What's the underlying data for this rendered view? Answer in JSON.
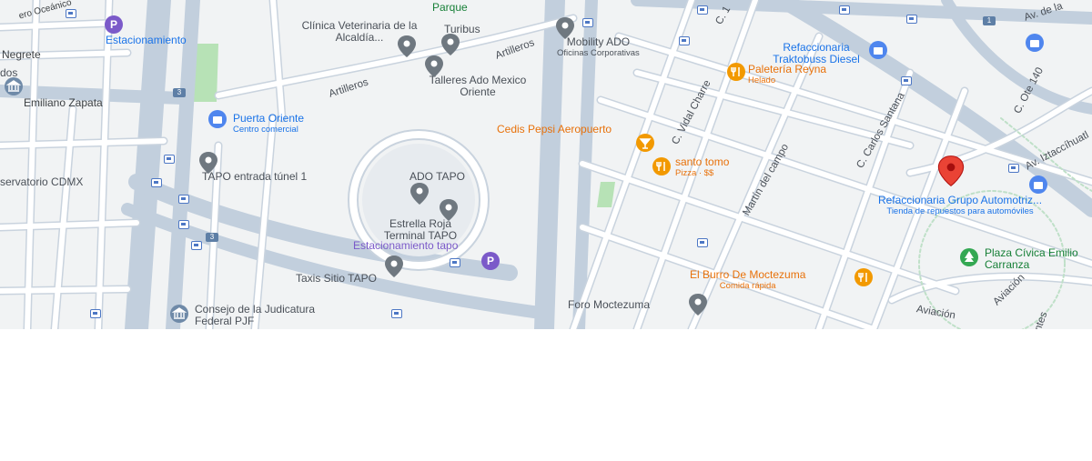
{
  "map": {
    "colors": {
      "background": "#f1f3f4",
      "road": "#ffffff",
      "road_outline": "#c9d3de",
      "highway": "#c2cfdd",
      "park": "#b7e2b6",
      "gray_pin": "#6f7880",
      "blue_pin": "#4f86ee",
      "orange_pin": "#f29900",
      "purple_pin": "#7b5ac9",
      "green_pin": "#34a853",
      "red_marker": "#ea4335"
    },
    "roads": {
      "oceanico": "ero Oceánico",
      "negrete": "Negrete",
      "emiliano_zapata": "Emiliano Zapata",
      "artilleros_1": "Artilleros",
      "artilleros_2": "Artilleros",
      "vidal_charre": "C. Vidal Charre",
      "martin_del_campo": "Martín del campo",
      "carlos_santana": "C. Carlos Santana",
      "ote_140": "C. Ote 140",
      "izazaga": "Av. Iztaccíhuatl",
      "aviacion_1": "Aviación",
      "aviacion_2": "Aviación",
      "av_de_la": "Av. de la",
      "c1": "C. 1",
      "intes": "intes"
    },
    "shields": [
      "3",
      "3",
      "1"
    ],
    "places": {
      "estacionamiento": "Estacionamiento",
      "parque": "Parque",
      "veterinaria": "Clínica Veterinaria de la Alcaldía...",
      "turibus": "Turibus",
      "mobility_ado": "Mobility ADO",
      "mobility_ado_sub": "Oficinas Corporativas",
      "refaccionaria_traktobuss": "Refaccionaria Traktobuss Diesel",
      "paleteria": "Paletería Reyna",
      "paleteria_sub": "Helado",
      "talleres_ado": "Talleres Ado Mexico Oriente",
      "dos": "dos",
      "puerta_oriente": "Puerta Oriente",
      "puerta_oriente_sub": "Centro comercial",
      "cedis_pepsi": "Cedis Pepsi Aeropuerto",
      "santo_tomo": "santo tomo",
      "santo_tomo_sub": "Pizza · $$",
      "tapo_tunel": "TAPO entrada túnel 1",
      "observatorio": "servatorio CDMX",
      "ado_tapo": "ADO TAPO",
      "estrella_roja": "Estrella Roja Terminal TAPO",
      "refaccionaria_grupo": "Refaccionaria Grupo Automotriz...",
      "refaccionaria_grupo_sub": "Tienda de repuestos para automóviles",
      "estacionamiento_tapo": "Estacionamiento tapo",
      "plaza_civica": "Plaza Cívica Emilio Carranza",
      "taxis_sitio": "Taxis Sitio TAPO",
      "burro": "El Burro De Moctezuma",
      "burro_sub": "Comida rápida",
      "consejo": "Consejo de la Judicatura Federal PJF",
      "foro_moctezuma": "Foro Moctezuma"
    }
  }
}
